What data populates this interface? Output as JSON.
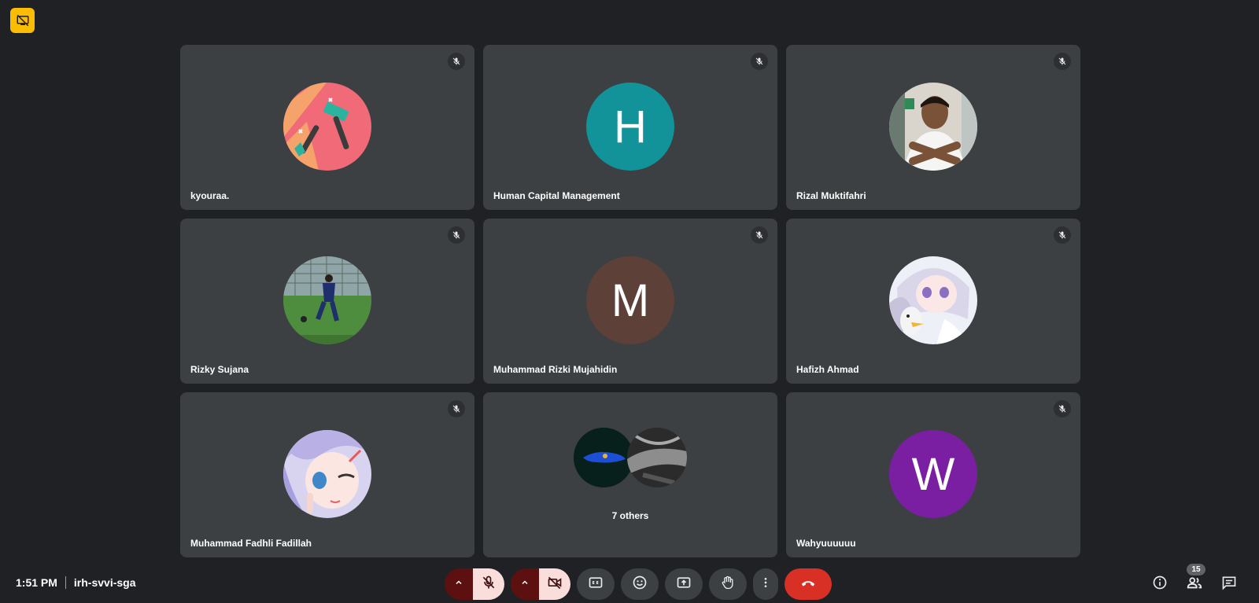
{
  "meeting": {
    "time": "1:51 PM",
    "code": "irh-svvi-sga"
  },
  "participants": [
    {
      "name": "kyouraa.",
      "avatar": "hammer-illustration",
      "muted": true
    },
    {
      "name": "Human Capital Management",
      "avatar_letter": "H",
      "avatar_color": "#12939a",
      "muted": true
    },
    {
      "name": "Rizal Muktifahri",
      "avatar": "photo-person",
      "muted": true
    },
    {
      "name": "Rizky Sujana",
      "avatar": "photo-football",
      "muted": true
    },
    {
      "name": "Muhammad Rizki Mujahidin",
      "avatar_letter": "M",
      "avatar_color": "#5d4037",
      "muted": true
    },
    {
      "name": "Hafizh Ahmad",
      "avatar": "anime-character",
      "muted": true
    },
    {
      "name": "Muhammad Fadhli Fadillah",
      "avatar": "anime-character",
      "muted": true
    },
    {
      "name": "7 others",
      "avatar": "group-avatars",
      "muted": false
    },
    {
      "name": "Wahyuuuuuu",
      "avatar_letter": "W",
      "avatar_color": "#7b1fa2",
      "muted": true
    }
  ],
  "controls": {
    "participant_count": "15"
  },
  "colors": {
    "background": "#202124",
    "tile": "#3c4043",
    "accent_yellow": "#fbbc04",
    "hangup_red": "#d93025"
  }
}
